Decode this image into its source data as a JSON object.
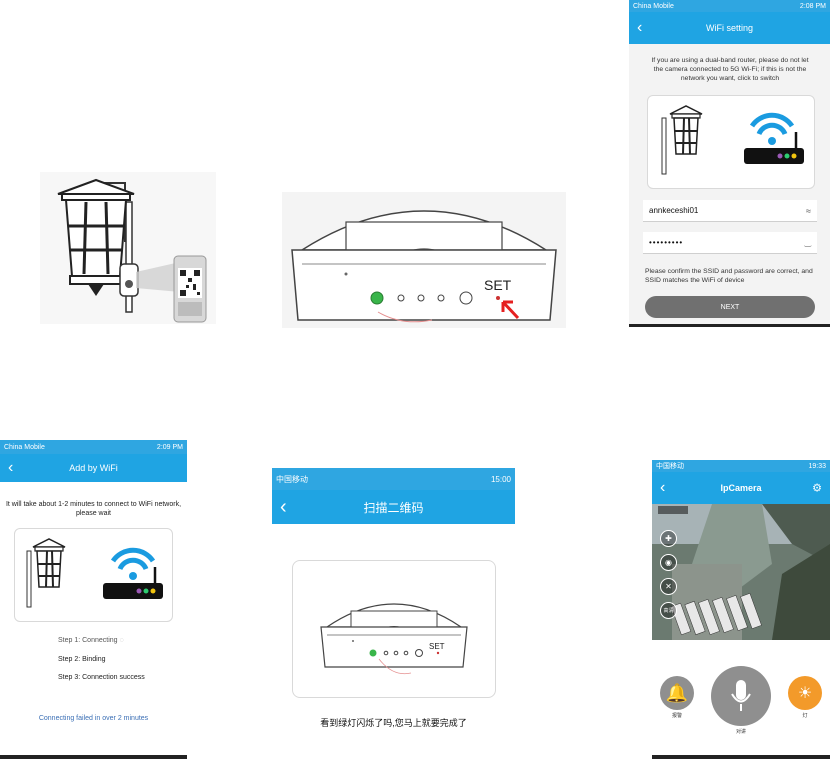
{
  "wifi_setting": {
    "status_carrier": "China Mobile",
    "status_time": "2:08 PM",
    "title": "WiFi setting",
    "info_text": "If you are using a dual-band router, please do not let the camera connected to 5G Wi-Fi; if this is not the network you want, click to switch",
    "switch_label": "switch",
    "ssid_value": "annkeceshi01",
    "password_value": "•••••••••",
    "confirm_text": "Please confirm the SSID and password are correct, and SSID matches the WiFi of device",
    "next_label": "NEXT"
  },
  "device_figure": {
    "set_label": "SET"
  },
  "add_by_wifi": {
    "status_carrier": "China Mobile",
    "status_time": "2:09 PM",
    "title": "Add by WiFi",
    "info_text": "It will take about 1-2 minutes to connect to WiFi network, please wait",
    "step1": "Step 1: Connecting",
    "step2": "Step 2: Binding",
    "step3": "Step 3: Connection success",
    "failed_text": "Connecting failed in over 2 minutes"
  },
  "scan_qr": {
    "status_carrier": "中国移动",
    "status_time": "15:00",
    "title": "扫描二维码",
    "set_label": "SET",
    "hint_text": "看到绿灯闪烁了吗,您马上就要完成了"
  },
  "ipcamera": {
    "status_carrier": "中国移动",
    "status_time": "19:33",
    "title": "IpCamera",
    "hd_label": "高清",
    "alarm_label": "报警",
    "talk_label": "对讲",
    "light_label": "灯"
  },
  "colors": {
    "accent": "#1fa4e3",
    "next_button": "#707070",
    "green_led": "#39b54a",
    "light_orange": "#f39a2a"
  }
}
